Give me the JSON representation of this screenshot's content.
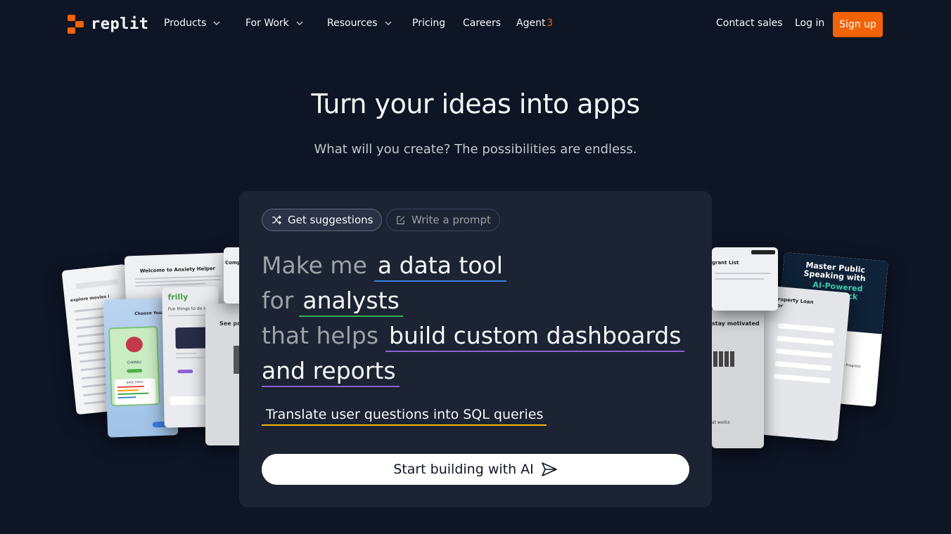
{
  "brand": {
    "name": "replit",
    "accent": "#f26207"
  },
  "nav": {
    "products": "Products",
    "for_work": "For Work",
    "resources": "Resources",
    "pricing": "Pricing",
    "careers": "Careers",
    "agent": "Agent",
    "agent_version": "3",
    "contact_sales": "Contact sales",
    "log_in": "Log in",
    "sign_up": "Sign up"
  },
  "hero": {
    "title": "Turn your ideas into apps",
    "subtitle": "What will you create? The possibilities are endless."
  },
  "prompt_panel": {
    "tab_suggestions": "Get suggestions",
    "tab_write": "Write a prompt",
    "sentence": {
      "p1": "Make me",
      "h1": "a data tool",
      "p2": "for",
      "h2": "analysts",
      "p3": "that helps",
      "h3": "build custom dashboards",
      "h4": "and reports"
    },
    "alternative": "Translate user questions into SQL queries",
    "cta": "Start building with AI"
  },
  "collage": {
    "left": {
      "anxiety_title": "Welcome to Anxiety Helper",
      "explore": "explore movies i",
      "choose": "Choose Your P",
      "pokemon_name": "CHIMAU",
      "base_stats": "BASE STATS",
      "frilly": "frilly",
      "frilly_q": "Fun things to do in",
      "see": "See pro",
      "comp": "Comp"
    },
    "right": {
      "grant": "grant List",
      "stay": "stay motivated",
      "loan": "Single Property Loan Calculator",
      "master": "Master Public Speaking with",
      "ai_powered": "AI-Powered",
      "feedback": "Feedback",
      "track": "Track Progress",
      "works": "at works"
    }
  }
}
